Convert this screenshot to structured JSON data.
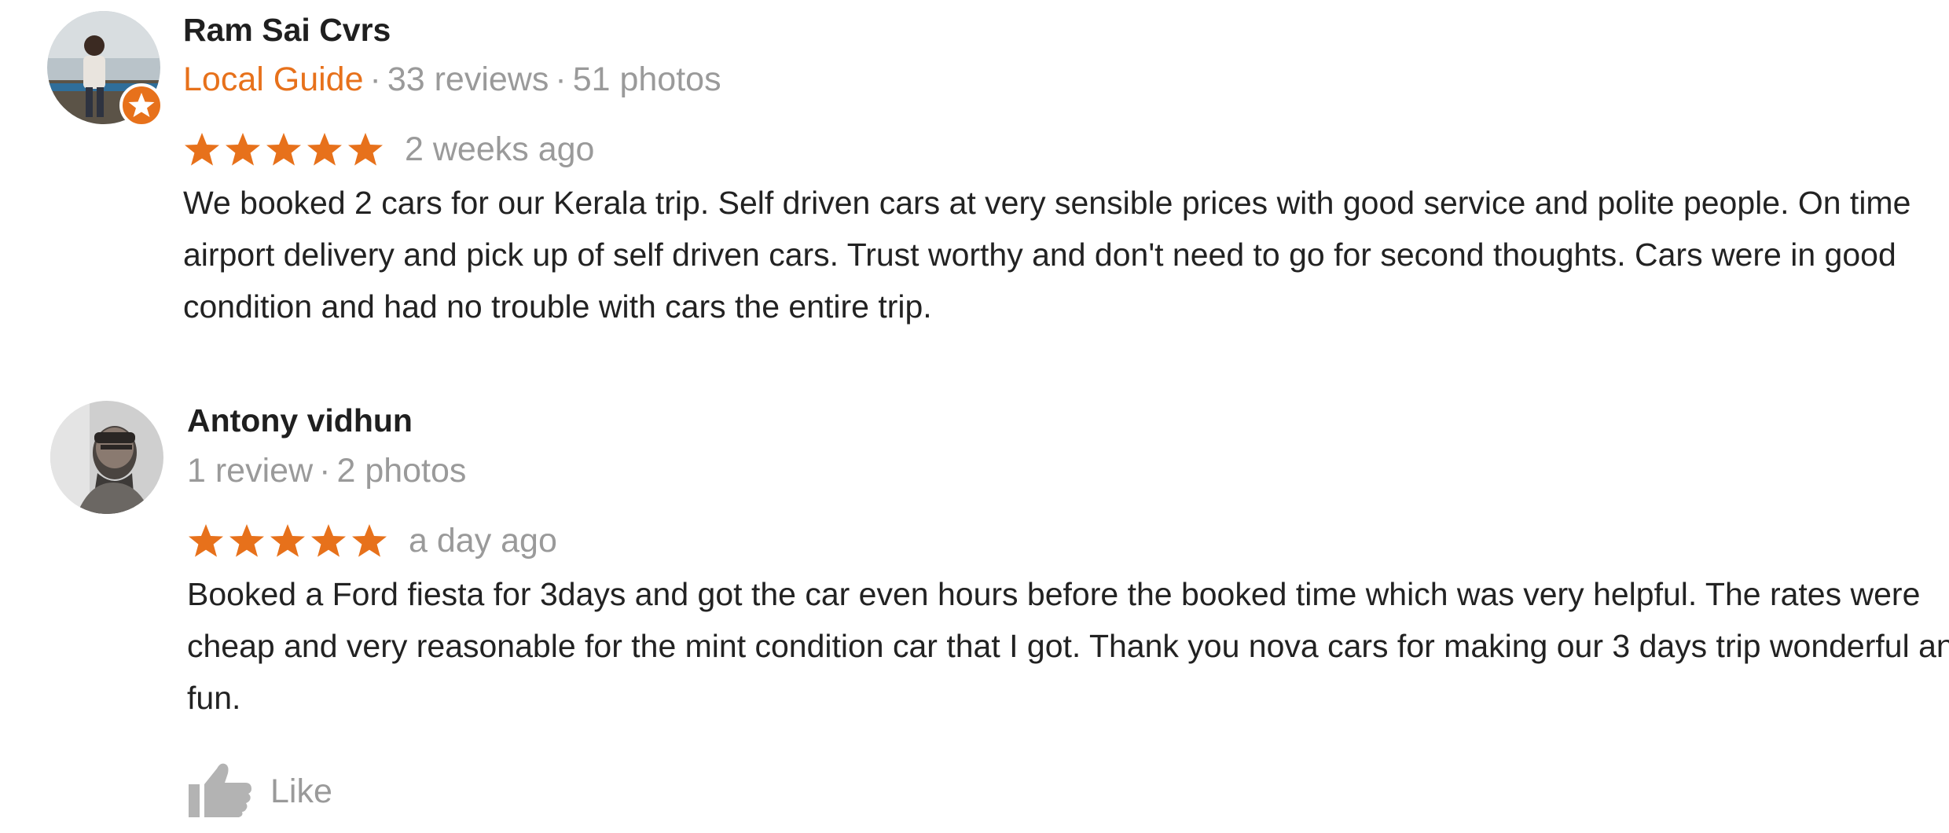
{
  "reviews": [
    {
      "reviewer_name": "Ram Sai Cvrs",
      "guide_label": "Local Guide",
      "review_count": "33 reviews",
      "photo_count": "51 photos",
      "rating": 5,
      "time": "2 weeks ago",
      "text": "We booked 2 cars for our Kerala trip. Self driven cars at very sensible prices with good service and polite people. On time airport delivery and pick up of self driven cars. Trust worthy and don't need to go for second thoughts. Cars were in good condition and had no trouble with cars the entire trip.",
      "avatar_icon": "user-photo-avatar",
      "badge_icon": "local-guide-star-badge-icon"
    },
    {
      "reviewer_name": "Antony vidhun",
      "review_count": "1 review",
      "photo_count": "2 photos",
      "rating": 5,
      "time": "a day ago",
      "text": "Booked a Ford fiesta for 3days and got the car even hours before the booked time which was very helpful. The rates were cheap and very reasonable for the mint condition car that I got. Thank you nova cars for making our 3 days trip wonderful and fun.",
      "avatar_icon": "user-photo-avatar"
    }
  ],
  "like": {
    "label": "Like",
    "icon": "thumbs-up-icon"
  },
  "colors": {
    "star": "#e7711b",
    "guide": "#e7711b",
    "meta": "#9a9a9a",
    "text": "#222222"
  },
  "separator": "·"
}
